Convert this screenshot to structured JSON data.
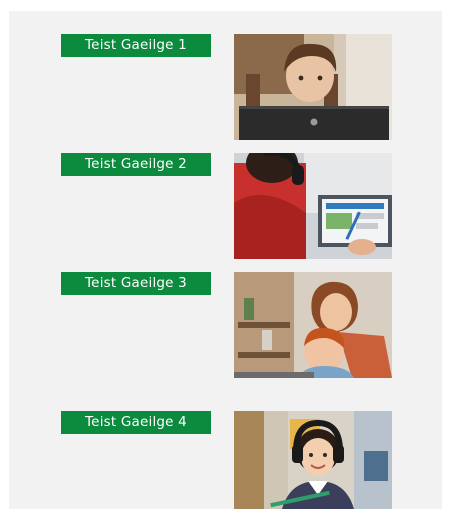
{
  "tests": [
    {
      "label": "Teist Gaeilge 1",
      "image_icon": "boy-at-laptop-photo"
    },
    {
      "label": "Teist Gaeilge 2",
      "image_icon": "child-with-headphones-and-laptop-photo"
    },
    {
      "label": "Teist Gaeilge 3",
      "image_icon": "mother-and-son-at-laptop-photo"
    },
    {
      "label": "Teist Gaeilge 4",
      "image_icon": "girl-with-headphones-photo"
    }
  ],
  "colors": {
    "accent": "#0c8a3d",
    "panel_background": "#f2f2f2",
    "button_text": "#ffffff"
  }
}
